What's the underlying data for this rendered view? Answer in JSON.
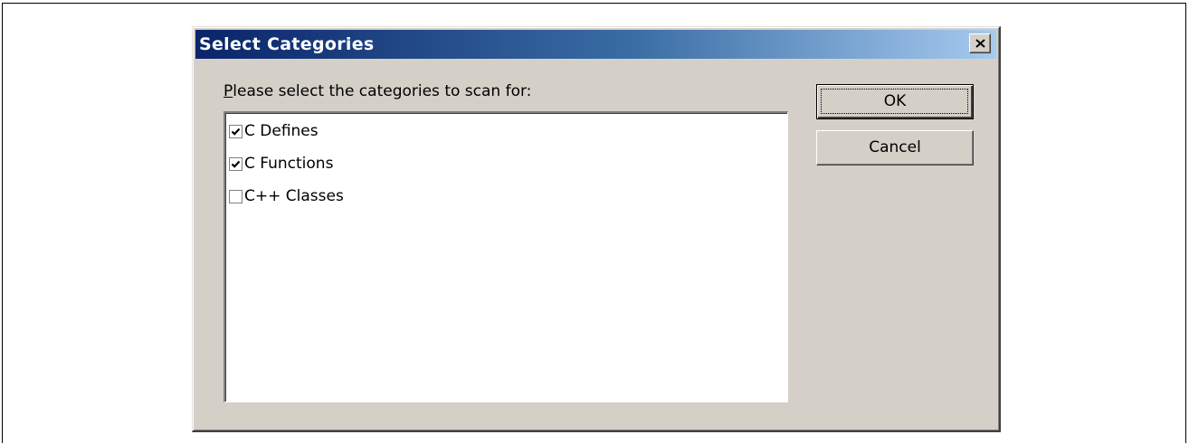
{
  "dialog": {
    "title": "Select Categories",
    "close_icon": "close-icon",
    "prompt_mnemonic": "P",
    "prompt_rest": "lease select the categories to scan for:",
    "categories": [
      {
        "label": "C Defines",
        "checked": true
      },
      {
        "label": "C Functions",
        "checked": true
      },
      {
        "label": "C++ Classes",
        "checked": false
      }
    ],
    "ok_label": "OK",
    "cancel_label": "Cancel"
  },
  "colors": {
    "title_gradient_start": "#0a246a",
    "title_gradient_end": "#a6caf0",
    "dialog_face": "#d4d0c8"
  }
}
